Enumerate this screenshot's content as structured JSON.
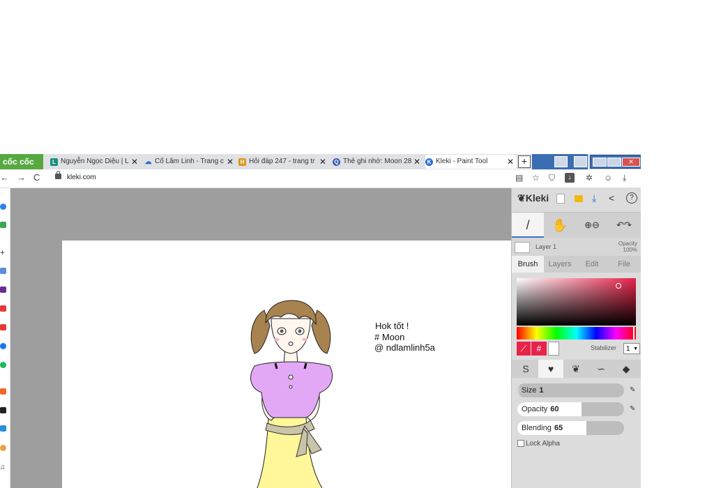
{
  "browser": {
    "brand": "cốc cốc",
    "tabs": [
      {
        "title": "Nguyễn Ngọc Diệu | L",
        "fav": "L",
        "color": "#1a8f7a"
      },
      {
        "title": "Cố Lâm Linh - Trang c",
        "fav": "☁",
        "color": "#2d6cc9"
      },
      {
        "title": "Hỏi đáp 247 - trang tr",
        "fav": "H",
        "color": "#d89a18"
      },
      {
        "title": "Thẻ ghi nhớ: Moon 28",
        "fav": "Q",
        "color": "#3d5bb8"
      },
      {
        "title": "Kleki - Paint Tool",
        "fav": "K",
        "color": "#2a6fd6"
      }
    ],
    "close_glyph": "✕",
    "newtab_glyph": "+",
    "url": "kleki.com",
    "back_glyph": "←",
    "forward_glyph": "→",
    "reload_glyph": "C"
  },
  "artwork": {
    "line1": "Hok tốt !",
    "line2": "# Moon",
    "line3": "@ ndlamlinh5a"
  },
  "kleki": {
    "logo": "Kleki",
    "layer_name": "Layer 1",
    "opacity_label": "Opacity",
    "opacity_value": "100%",
    "tabs": [
      "Brush",
      "Layers",
      "Edit",
      "File"
    ],
    "hex_glyph": "#",
    "stabilizer_label": "Stabilizer",
    "stabilizer_value": "1",
    "size_label": "Size",
    "size_value": "1",
    "size_fraction": 0.02,
    "opacity_slider_label": "Opacity",
    "opacity_slider_value": "60",
    "opacity_fraction": 0.6,
    "blending_label": "Blending",
    "blending_value": "65",
    "blending_fraction": 0.65,
    "lock_alpha_label": "Lock Alpha",
    "colors": {
      "primary": "#e8234a",
      "secondary": "#ffffff"
    }
  }
}
